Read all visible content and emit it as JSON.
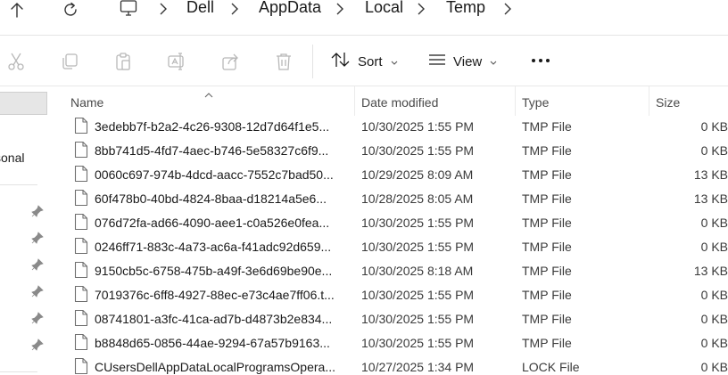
{
  "breadcrumb": [
    "Dell",
    "AppData",
    "Local",
    "Temp"
  ],
  "toolbar": {
    "sort_label": "Sort",
    "view_label": "View",
    "icons": [
      "cut-icon",
      "copy-icon",
      "paste-icon",
      "rename-icon",
      "share-icon",
      "delete-icon"
    ]
  },
  "navpane": {
    "quick_access_label": "sonal",
    "pinned_count": 6
  },
  "columns": {
    "name": "Name",
    "date": "Date modified",
    "type": "Type",
    "size": "Size"
  },
  "files": [
    {
      "name": "3edebb7f-b2a2-4c26-9308-12d7d64f1e5...",
      "date": "10/30/2025 1:55 PM",
      "type": "TMP File",
      "size": "0 KB"
    },
    {
      "name": "8bb741d5-4fd7-4aec-b746-5e58327c6f9...",
      "date": "10/30/2025 1:55 PM",
      "type": "TMP File",
      "size": "0 KB"
    },
    {
      "name": "0060c697-974b-4dcd-aacc-7552c7bad50...",
      "date": "10/29/2025 8:09 AM",
      "type": "TMP File",
      "size": "13 KB"
    },
    {
      "name": "60f478b0-40bd-4824-8baa-d18214a5e6...",
      "date": "10/28/2025 8:05 AM",
      "type": "TMP File",
      "size": "13 KB"
    },
    {
      "name": "076d72fa-ad66-4090-aee1-c0a526e0fea...",
      "date": "10/30/2025 1:55 PM",
      "type": "TMP File",
      "size": "0 KB"
    },
    {
      "name": "0246ff71-883c-4a73-ac6a-f41adc92d659...",
      "date": "10/30/2025 1:55 PM",
      "type": "TMP File",
      "size": "0 KB"
    },
    {
      "name": "9150cb5c-6758-475b-a49f-3e6d69be90e...",
      "date": "10/30/2025 8:18 AM",
      "type": "TMP File",
      "size": "13 KB"
    },
    {
      "name": "7019376c-6ff8-4927-88ec-e73c4ae7ff06.t...",
      "date": "10/30/2025 1:55 PM",
      "type": "TMP File",
      "size": "0 KB"
    },
    {
      "name": "08741801-a3fc-41ca-ad7b-d4873b2e834...",
      "date": "10/30/2025 1:55 PM",
      "type": "TMP File",
      "size": "0 KB"
    },
    {
      "name": "b8848d65-0856-44ae-9294-67a57b9163...",
      "date": "10/30/2025 1:55 PM",
      "type": "TMP File",
      "size": "0 KB"
    },
    {
      "name": "CUsersDellAppDataLocalProgramsOpera...",
      "date": "10/27/2025 1:34 PM",
      "type": "LOCK File",
      "size": "0 KB"
    }
  ]
}
